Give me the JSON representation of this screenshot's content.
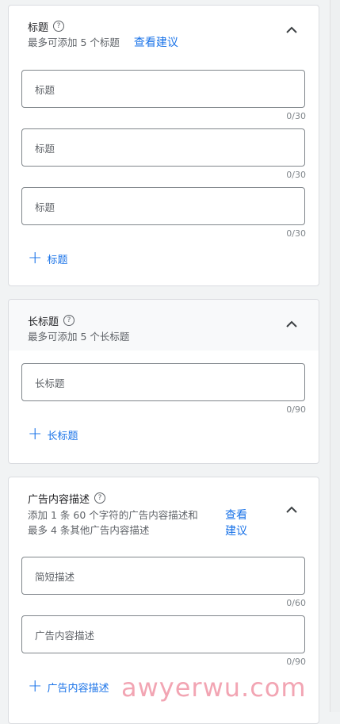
{
  "headlines": {
    "title": "标题",
    "subtitle": "最多可添加 5 个标题",
    "suggest": "查看建议",
    "fields": [
      {
        "placeholder": "标题",
        "counter": "0/30"
      },
      {
        "placeholder": "标题",
        "counter": "0/30"
      },
      {
        "placeholder": "标题",
        "counter": "0/30"
      }
    ],
    "add_label": "标题"
  },
  "long_headlines": {
    "title": "长标题",
    "subtitle": "最多可添加 5 个长标题",
    "fields": [
      {
        "placeholder": "长标题",
        "counter": "0/90"
      }
    ],
    "add_label": "长标题"
  },
  "descriptions": {
    "title": "广告内容描述",
    "subtitle_line1": "添加 1 条 60 个字符的广告内容描述和",
    "subtitle_line2": "最多 4 条其他广告内容描述",
    "suggest_line1": "查看",
    "suggest_line2": "建议",
    "fields": [
      {
        "placeholder": "简短描述",
        "counter": "0/60"
      },
      {
        "placeholder": "广告内容描述",
        "counter": "0/90"
      }
    ],
    "add_label": "广告内容描述"
  },
  "help_icon_glyph": "?",
  "plus_glyph": "+",
  "watermark": "awyerwu.com"
}
